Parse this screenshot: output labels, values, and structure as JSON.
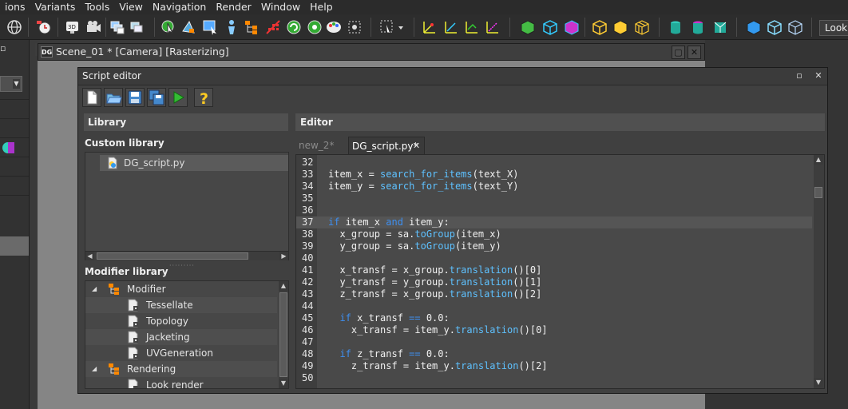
{
  "menubar": {
    "items": [
      "ions",
      "Variants",
      "Tools",
      "View",
      "Navigation",
      "Render",
      "Window",
      "Help"
    ]
  },
  "toolbar": {
    "look_button_label": "Look r"
  },
  "scene": {
    "title": "Scene_01 * [Camera] [Rasterizing]",
    "icon_label": "DG"
  },
  "script_editor": {
    "title": "Script editor",
    "toolbar_icons": [
      "new-file-icon",
      "open-folder-icon",
      "save-icon",
      "save-all-icon",
      "run-icon",
      "help-icon"
    ]
  },
  "library": {
    "header": "Library",
    "custom_library_label": "Custom library",
    "custom_files": [
      "DG_script.py"
    ],
    "modifier_library_label": "Modifier library",
    "tree": [
      {
        "label": "Modifier",
        "level": 0,
        "expanded": true
      },
      {
        "label": "Tessellate",
        "level": 1
      },
      {
        "label": "Topology",
        "level": 1
      },
      {
        "label": "Jacketing",
        "level": 1
      },
      {
        "label": "UVGeneration",
        "level": 1
      },
      {
        "label": "Rendering",
        "level": 0,
        "expanded": true
      },
      {
        "label": "Look render",
        "level": 1
      }
    ]
  },
  "editor": {
    "header": "Editor",
    "tabs": [
      {
        "label": "new_2*",
        "active": false
      },
      {
        "label": "DG_script.py*",
        "active": true
      }
    ],
    "current_line": 37,
    "lines": [
      {
        "n": "32",
        "t": ""
      },
      {
        "n": "33",
        "t": "item_x = search_for_items(text_X)"
      },
      {
        "n": "34",
        "t": "item_y = search_for_items(text_Y)"
      },
      {
        "n": "35",
        "t": ""
      },
      {
        "n": "36",
        "t": ""
      },
      {
        "n": "37",
        "t": "if item_x and item_y:"
      },
      {
        "n": "38",
        "t": "  x_group = sa.toGroup(item_x)"
      },
      {
        "n": "39",
        "t": "  y_group = sa.toGroup(item_y)"
      },
      {
        "n": "40",
        "t": ""
      },
      {
        "n": "41",
        "t": "  x_transf = x_group.translation()[0]"
      },
      {
        "n": "42",
        "t": "  y_transf = y_group.translation()[1]"
      },
      {
        "n": "43",
        "t": "  z_transf = x_group.translation()[2]"
      },
      {
        "n": "44",
        "t": ""
      },
      {
        "n": "45",
        "t": "  if x_transf == 0.0:"
      },
      {
        "n": "46",
        "t": "    x_transf = item_y.translation()[0]"
      },
      {
        "n": "47",
        "t": ""
      },
      {
        "n": "48",
        "t": "  if z_transf == 0.0:"
      },
      {
        "n": "49",
        "t": "    z_transf = item_y.translation()[2]"
      },
      {
        "n": "50",
        "t": ""
      }
    ]
  },
  "colors": {
    "keyword": "#3e8ff0",
    "function": "#5ec1ff",
    "panel_bg": "#404040",
    "viewport_bg": "#858585"
  }
}
